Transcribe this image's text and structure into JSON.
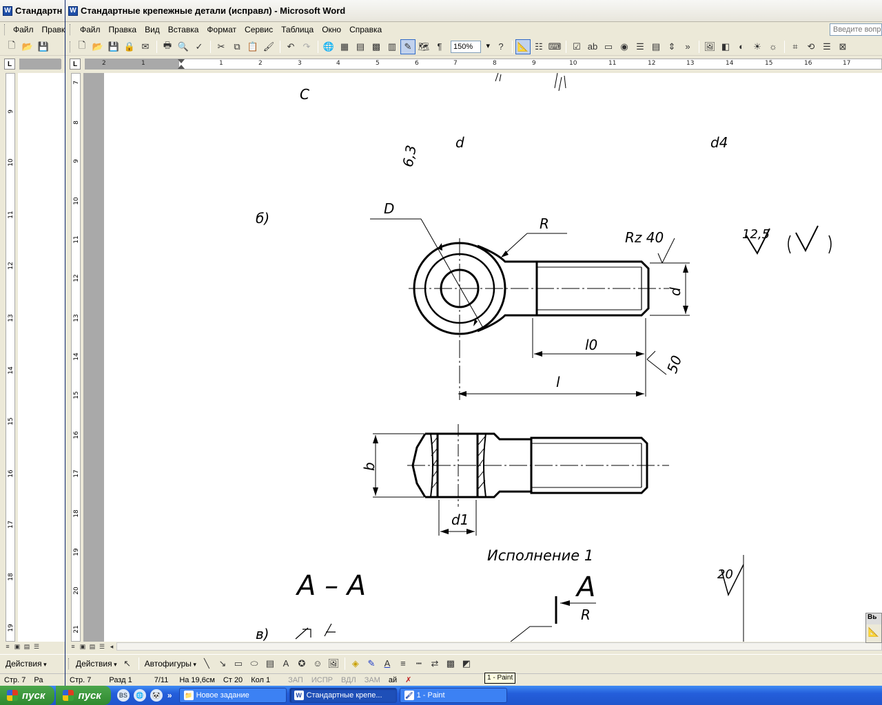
{
  "back_window": {
    "title": "Стандартн",
    "menu": [
      "Файл",
      "Правк"
    ],
    "actions_label": "Действия",
    "status_page": "Стр. 7",
    "status_extra": "Ра",
    "start_label": "пуск"
  },
  "window": {
    "title": "Стандартные крепежные детали (исправл) - Microsoft Word",
    "app_icon": "word-icon"
  },
  "menu": [
    "Файл",
    "Правка",
    "Вид",
    "Вставка",
    "Формат",
    "Сервис",
    "Таблица",
    "Окно",
    "Справка"
  ],
  "ask_placeholder": "Введите вопрос",
  "toolbar": {
    "zoom": "150%"
  },
  "ruler": {
    "h_numbers": [
      "2",
      "1",
      "1",
      "2",
      "3",
      "4",
      "5",
      "6",
      "7",
      "8",
      "9",
      "10",
      "11",
      "12",
      "13",
      "14",
      "15",
      "16",
      "17"
    ],
    "v_numbers": [
      "7",
      "8",
      "9",
      "10",
      "11",
      "12",
      "13",
      "14",
      "15",
      "16",
      "17",
      "18",
      "19",
      "20",
      "21"
    ],
    "back_v_numbers": [
      "9",
      "10",
      "11",
      "12",
      "13",
      "14",
      "15",
      "16",
      "17",
      "18",
      "19"
    ]
  },
  "drawing": {
    "top_labels": [
      "C",
      "d",
      "d4",
      "6,3"
    ],
    "variant_b": "б)",
    "variant_v": "в)",
    "D": "D",
    "R": "R",
    "rz40": "Rz 40",
    "roughness_main": "12,5",
    "roughness_paren": "( √ )",
    "d": "d",
    "l0": "l0",
    "l": "l",
    "r50": "50",
    "b": "b",
    "d1": "d1",
    "caption": "Исполнение 1",
    "section": "A – A",
    "section_letter": "A",
    "r_bottom": "R",
    "roughness_20": "20"
  },
  "draw_toolbar": {
    "actions": "Действия",
    "autoshapes": "Автофигуры"
  },
  "status": {
    "page": "Стр. 7",
    "section": "Разд 1",
    "pages": "7/11",
    "at": "На 19,6см",
    "line": "Ст 20",
    "col": "Кол 1",
    "rec": "ЗАП",
    "trk": "ИСПР",
    "ext": "ВДЛ",
    "ovr": "ЗАМ",
    "lang": "ай"
  },
  "tooltip": "1 - Paint",
  "right_panel_title": "Вь",
  "taskbar": {
    "start": "пуск",
    "tasks": [
      {
        "label": "Новое задание",
        "icon": "folder-icon"
      },
      {
        "label": "Стандартные крепе...",
        "icon": "word-icon"
      },
      {
        "label": "1 - Paint",
        "icon": "paint-icon"
      }
    ]
  }
}
